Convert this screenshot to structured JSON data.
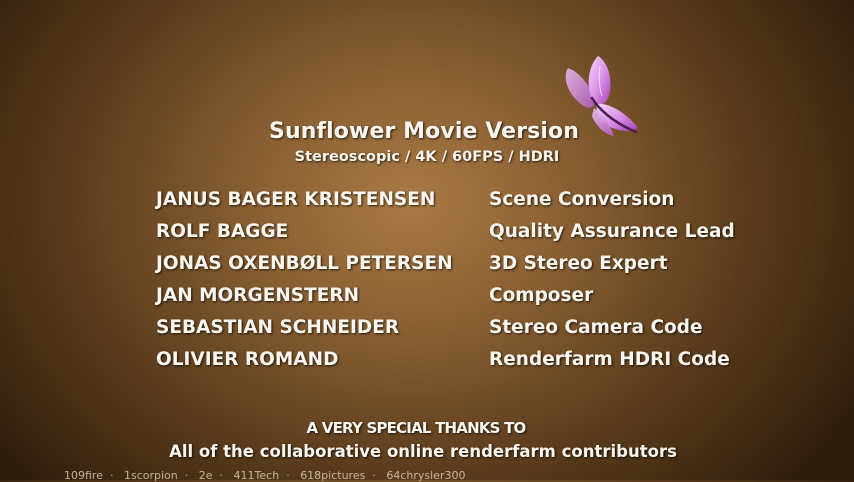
{
  "credits": {
    "title": "Sunflower Movie Version",
    "subtitle": "Stereoscopic / 4K / 60FPS / HDRI",
    "rows": [
      {
        "name": "JANUS BAGER KRISTENSEN",
        "role": "Scene Conversion"
      },
      {
        "name": "ROLF BAGGE",
        "role": "Quality Assurance Lead"
      },
      {
        "name": "JONAS OXENBØLL PETERSEN",
        "role": "3D Stereo Expert"
      },
      {
        "name": "JAN MORGENSTERN",
        "role": "Composer"
      },
      {
        "name": "SEBASTIAN SCHNEIDER",
        "role": "Stereo Camera Code"
      },
      {
        "name": "OLIVIER ROMAND",
        "role": "Renderfarm HDRI Code"
      }
    ],
    "thanks_heading": "A VERY SPECIAL THANKS TO",
    "thanks_line": "All of the collaborative online renderfarm contributors",
    "contributors": [
      "109fire",
      "1scorpion",
      "2e",
      "411Tech",
      "618pictures",
      "64chrysler300"
    ]
  },
  "decoration": {
    "butterfly_icon": "butterfly-icon",
    "butterfly_color": "#d98ee6"
  },
  "colors": {
    "text": "#fbf7ef",
    "background_center": "#a97a45",
    "background_edge": "#2e1c0b"
  }
}
